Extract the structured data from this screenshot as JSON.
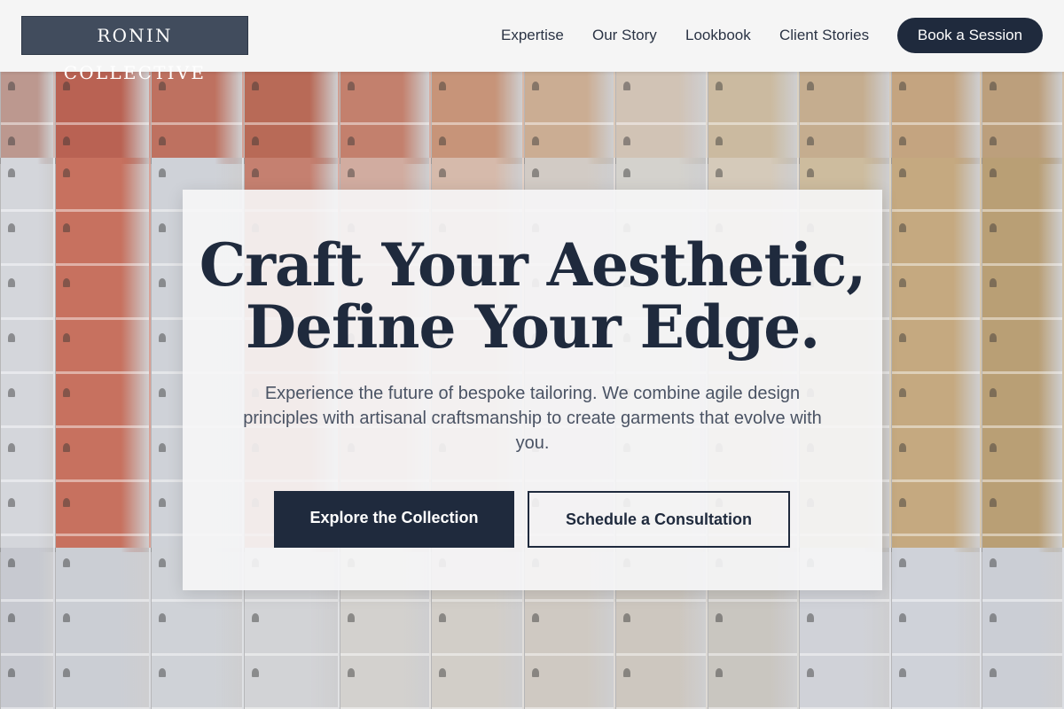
{
  "header": {
    "logo": "RONIN COLLECTIVE",
    "nav": [
      {
        "label": "Expertise"
      },
      {
        "label": "Our Story"
      },
      {
        "label": "Lookbook"
      },
      {
        "label": "Client Stories"
      }
    ],
    "cta_label": "Book a Session"
  },
  "hero": {
    "title_line1": "Craft Your Aesthetic,",
    "title_line2": "Define Your Edge.",
    "subtitle": "Experience the future of bespoke tailoring. We combine agile design principles with artisanal craftsmanship to create garments that evolve with you.",
    "primary_button": "Explore the Collection",
    "secondary_button": "Schedule a Consultation"
  },
  "colors": {
    "brand_dark": "#1f2a3d",
    "logo_bg": "#414c5d",
    "header_bg": "#f6f6f6",
    "card_bg": "#f6f6f7"
  },
  "background": {
    "description_icon": "paint-swatch-wall",
    "top_row_colors": [
      "#b9938a",
      "#b65a4a",
      "#bb6a58",
      "#b5634f",
      "#c07a66",
      "#c48f72",
      "#c9a98e",
      "#cfc0b2",
      "#c9b79b",
      "#c2a98a",
      "#c1a07a",
      "#b99a75"
    ],
    "mid_row_colors": [
      "#d2d4da",
      "#c46a57",
      "#cdd0d6",
      "#c27a69",
      "#cfa89b",
      "#d4b7a7",
      "#d0c9c2",
      "#d2d0cb",
      "#d3c8b7",
      "#cbb999",
      "#c2a57a",
      "#b69a6e"
    ],
    "bot_row_colors": [
      "#c4c7ce",
      "#c9ccd2",
      "#cdd0d5",
      "#d0d1d4",
      "#d1cfcc",
      "#d0ccc6",
      "#cdc7bf",
      "#cbc5bc",
      "#c7c3bd",
      "#ced0d6",
      "#cdd0d7",
      "#c9ccd3"
    ]
  }
}
